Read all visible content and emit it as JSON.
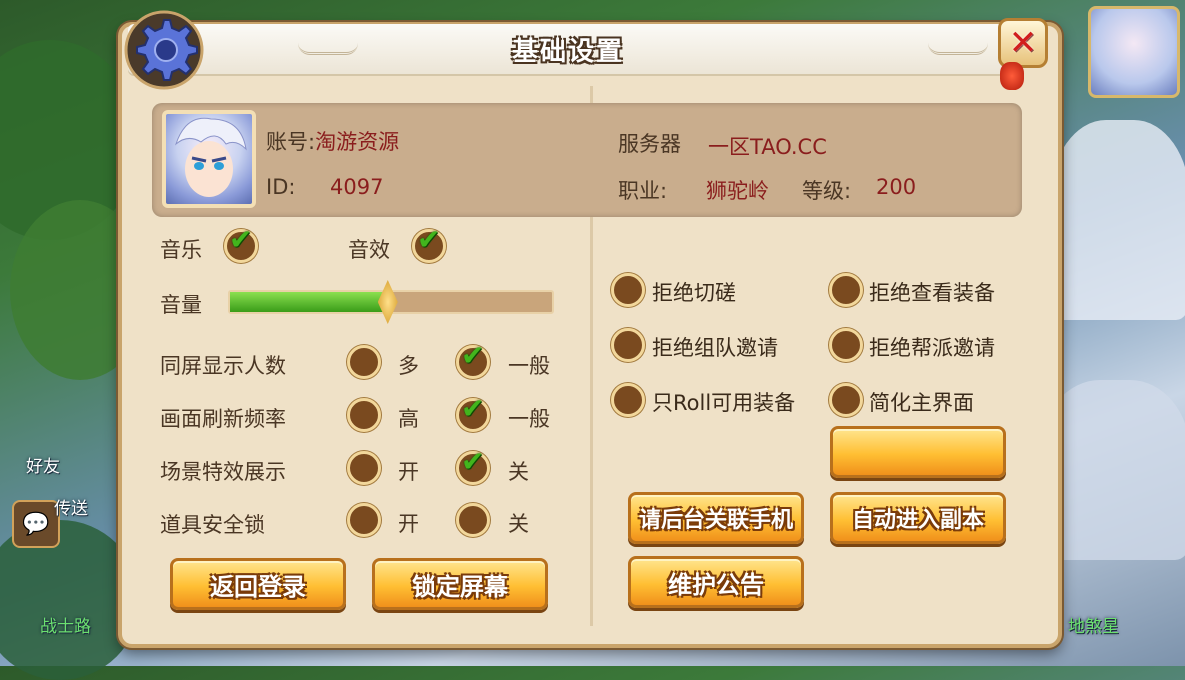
{
  "title": "基础设置",
  "background": {
    "friends_label": "好友",
    "chat_label": "传送",
    "map_left": "战士路",
    "map_right": "地煞星"
  },
  "account": {
    "label": "账号:",
    "name": "淘游资源",
    "id_label": "ID:",
    "id_value": "4097",
    "server_label": "服务器",
    "server_value": "一区TAO.CC",
    "class_label": "职业:",
    "class_value": "狮驼岭",
    "level_label": "等级:",
    "level_value": "200"
  },
  "audio": {
    "music_label": "音乐",
    "music_on": true,
    "sfx_label": "音效",
    "sfx_on": true,
    "volume_label": "音量",
    "volume": 0.49
  },
  "options": [
    {
      "label": "同屏显示人数",
      "opt1": "多",
      "opt2": "一般",
      "selected": 2
    },
    {
      "label": "画面刷新频率",
      "opt1": "高",
      "opt2": "一般",
      "selected": 2
    },
    {
      "label": "场景特效展示",
      "opt1": "开",
      "opt2": "关",
      "selected": 2
    },
    {
      "label": "道具安全锁",
      "opt1": "开",
      "opt2": "关",
      "selected": 0
    }
  ],
  "toggles": [
    {
      "label": "拒绝切磋",
      "checked": false
    },
    {
      "label": "拒绝查看装备",
      "checked": false
    },
    {
      "label": "拒绝组队邀请",
      "checked": false
    },
    {
      "label": "拒绝帮派邀请",
      "checked": false
    },
    {
      "label": "只Roll可用装备",
      "checked": false
    },
    {
      "label": "简化主界面",
      "checked": false
    }
  ],
  "buttons": {
    "back_login": "返回登录",
    "lock_screen": "锁定屏幕",
    "blank": "",
    "link_phone": "请后台关联手机",
    "auto_dungeon": "自动进入副本",
    "notice": "维护公告"
  },
  "colors": {
    "accent": "#ffbf33",
    "panel": "#efe1c7",
    "check": "#42b51d",
    "value_text": "#8a1d1d"
  }
}
